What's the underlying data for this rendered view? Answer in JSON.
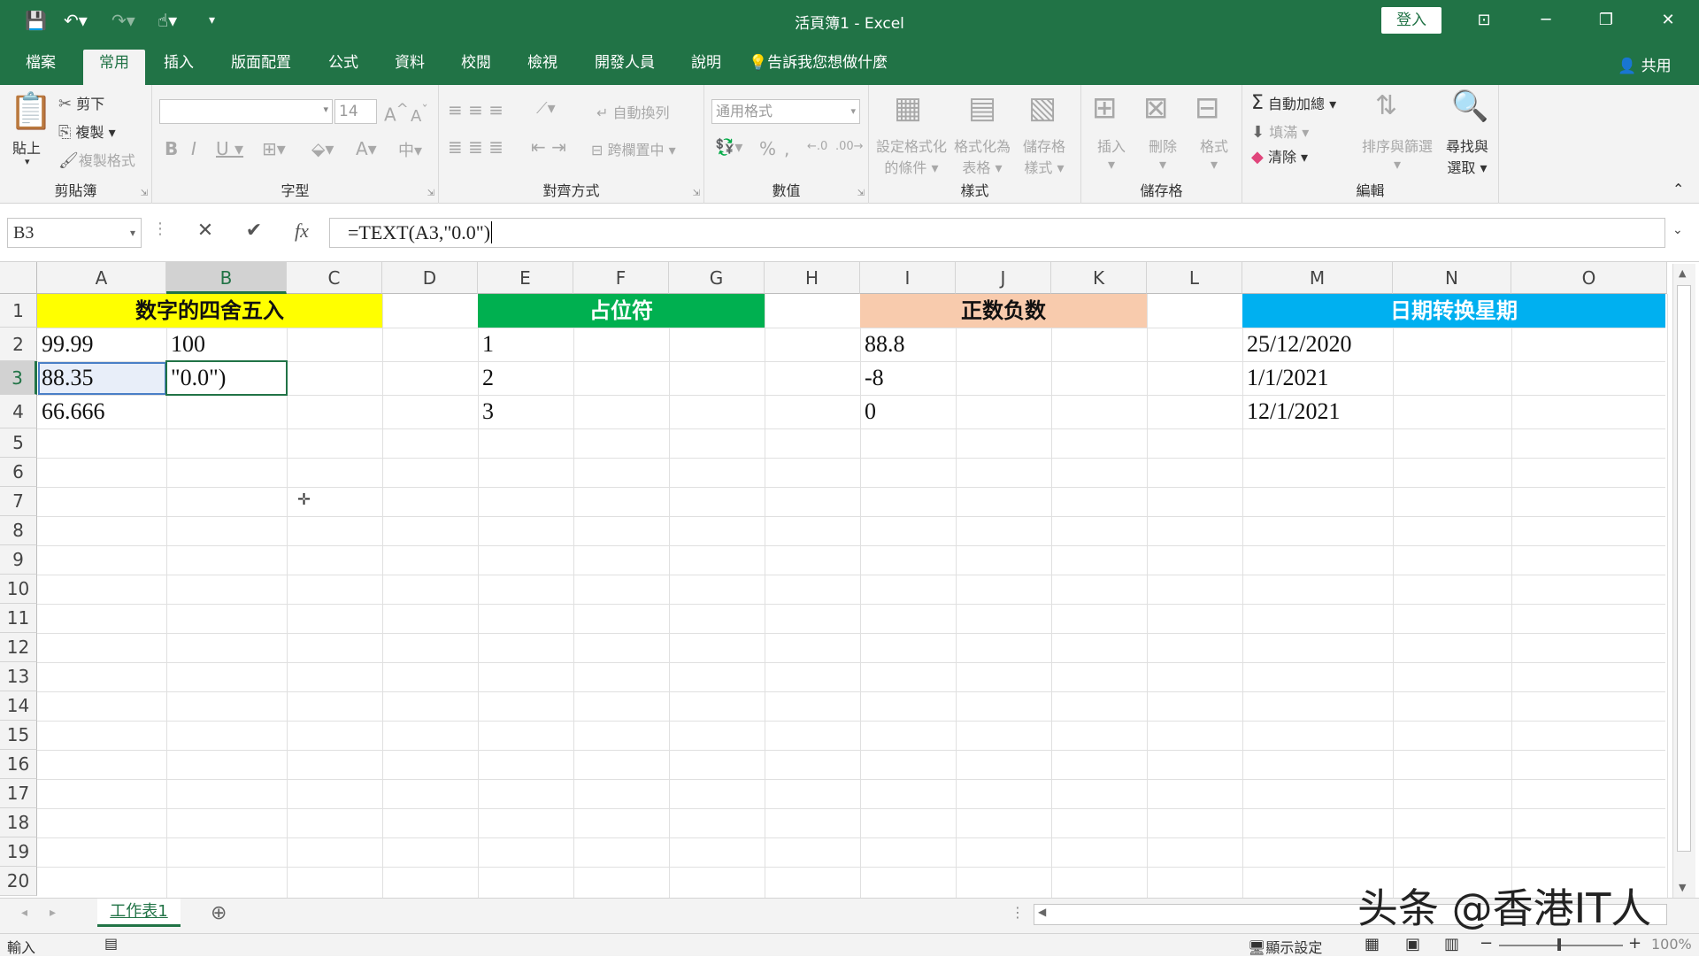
{
  "window": {
    "title": "活頁簿1 - Excel",
    "login_label": "登入"
  },
  "ribbon_tabs": [
    "檔案",
    "常用",
    "插入",
    "版面配置",
    "公式",
    "資料",
    "校閱",
    "檢視",
    "開發人員",
    "說明"
  ],
  "tell_me": "告訴我您想做什麼",
  "share_label": "共用",
  "ribbon": {
    "clipboard": {
      "paste": "貼上",
      "cut": "剪下",
      "copy": "複製",
      "format_painter": "複製格式",
      "label": "剪貼簿"
    },
    "font": {
      "size": "14",
      "label": "字型"
    },
    "alignment": {
      "wrap": "自動換列",
      "merge": "跨欄置中",
      "label": "對齊方式"
    },
    "number": {
      "format": "通用格式",
      "label": "數值"
    },
    "styles": {
      "conditional_1": "設定格式化",
      "conditional_2": "的條件",
      "table_1": "格式化為",
      "table_2": "表格",
      "cell_1": "儲存格",
      "cell_2": "樣式",
      "label": "樣式"
    },
    "cells": {
      "insert": "插入",
      "delete": "刪除",
      "format": "格式",
      "label": "儲存格"
    },
    "editing": {
      "autosum": "自動加總",
      "fill": "填滿",
      "clear": "清除",
      "sort": "排序與篩選",
      "find_1": "尋找與",
      "find_2": "選取",
      "label": "編輯"
    }
  },
  "formula_bar": {
    "name_box": "B3",
    "formula": "=TEXT(A3,\"0.0\")"
  },
  "columns": [
    "A",
    "B",
    "C",
    "D",
    "E",
    "F",
    "G",
    "H",
    "I",
    "J",
    "K",
    "L",
    "M",
    "N",
    "O"
  ],
  "rows": [
    "1",
    "2",
    "3",
    "4",
    "5",
    "6",
    "7",
    "8",
    "9",
    "10",
    "11",
    "12",
    "13",
    "14",
    "15",
    "16",
    "17",
    "18",
    "19",
    "20"
  ],
  "headers": {
    "rounding": "数字的四舍五入",
    "placeholder": "占位符",
    "posneg": "正数负数",
    "weekday": "日期转换星期"
  },
  "cells": {
    "A2": "99.99",
    "B2": "100",
    "A3": "88.35",
    "B3": "\"0.0\")",
    "A4": "66.666",
    "E2": "1",
    "E3": "2",
    "E4": "3",
    "I2": "88.8",
    "I3": "-8",
    "I4": "0",
    "M2": "25/12/2020",
    "M3": "1/1/2021",
    "M4": "12/1/2021"
  },
  "colors": {
    "excel_green": "#217346",
    "header_yellow": "#ffff00",
    "header_green": "#00b050",
    "header_peach": "#f8cbad",
    "header_blue": "#00b0f0"
  },
  "sheet": {
    "tab": "工作表1"
  },
  "status": {
    "mode": "輸入",
    "display_settings": "顯示設定",
    "zoom": "100%"
  },
  "watermark": "头条 @香港IT人"
}
